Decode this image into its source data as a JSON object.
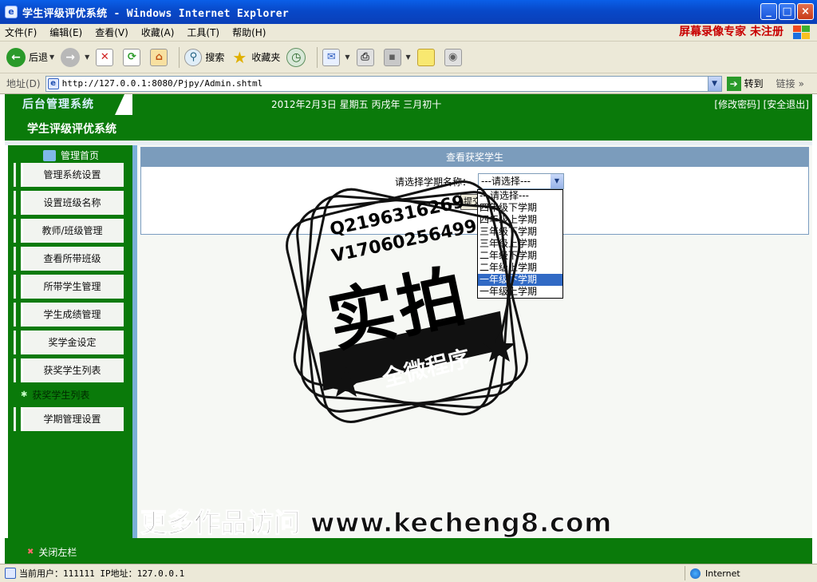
{
  "window": {
    "title": "学生评级评优系统 - Windows Internet Explorer",
    "buttons": {
      "minimize": "_",
      "maximize": "□",
      "close": "×"
    }
  },
  "menu": {
    "items": [
      "文件(F)",
      "编辑(E)",
      "查看(V)",
      "收藏(A)",
      "工具(T)",
      "帮助(H)"
    ],
    "unregistered_text": "屏幕录像专家  未注册"
  },
  "toolbar": {
    "back_label": "后退",
    "search_label": "搜索",
    "favorites_label": "收藏夹"
  },
  "address": {
    "label": "地址(D)",
    "url": "http://127.0.0.1:8080/Pjpy/Admin.shtml",
    "go_label": "转到",
    "links_label": "链接"
  },
  "header": {
    "logo_text": "后台管理系统",
    "date_text": "2012年2月3日 星期五 丙戌年 三月初十",
    "change_password": "[修改密码]",
    "logout": "[安全退出]",
    "system_title": "学生评级评优系统"
  },
  "sidebar": {
    "home_label": "管理首页",
    "items": [
      "管理系统设置",
      "设置班级名称",
      "教师/班级管理",
      "查看所带班级",
      "所带学生管理",
      "学生成绩管理",
      "奖学金设定",
      "获奖学生列表"
    ],
    "active_sub": "获奖学生列表",
    "last_item": "学期管理设置",
    "close_label": "关闭左栏"
  },
  "main": {
    "panel_title": "查看获奖学生",
    "select_label": "请选择学期名称：",
    "select_value": "---请选择---",
    "submit_label": "提交",
    "options": [
      "---请选择---",
      "四年级下学期",
      "四年级上学期",
      "三年级下学期",
      "三年级上学期",
      "二年级下学期",
      "二年级上学期",
      "一年级下学期",
      "一年级上学期"
    ],
    "highlighted_index": 7
  },
  "statusbar": {
    "text": "当前用户：111111  IP地址：127.0.0.1",
    "zone": "Internet"
  },
  "watermark": {
    "qq": "Q2196316269",
    "wechat": "V17060256499",
    "big": "实拍",
    "ribbon": "全微程序",
    "footer": "更多作品访问 www.kecheng8.com"
  },
  "colors": {
    "page_green": "#0a7a0a",
    "panel_header": "#7b9cbc",
    "selection_blue": "#316ac5",
    "titlebar_blue": "#0848c8"
  }
}
